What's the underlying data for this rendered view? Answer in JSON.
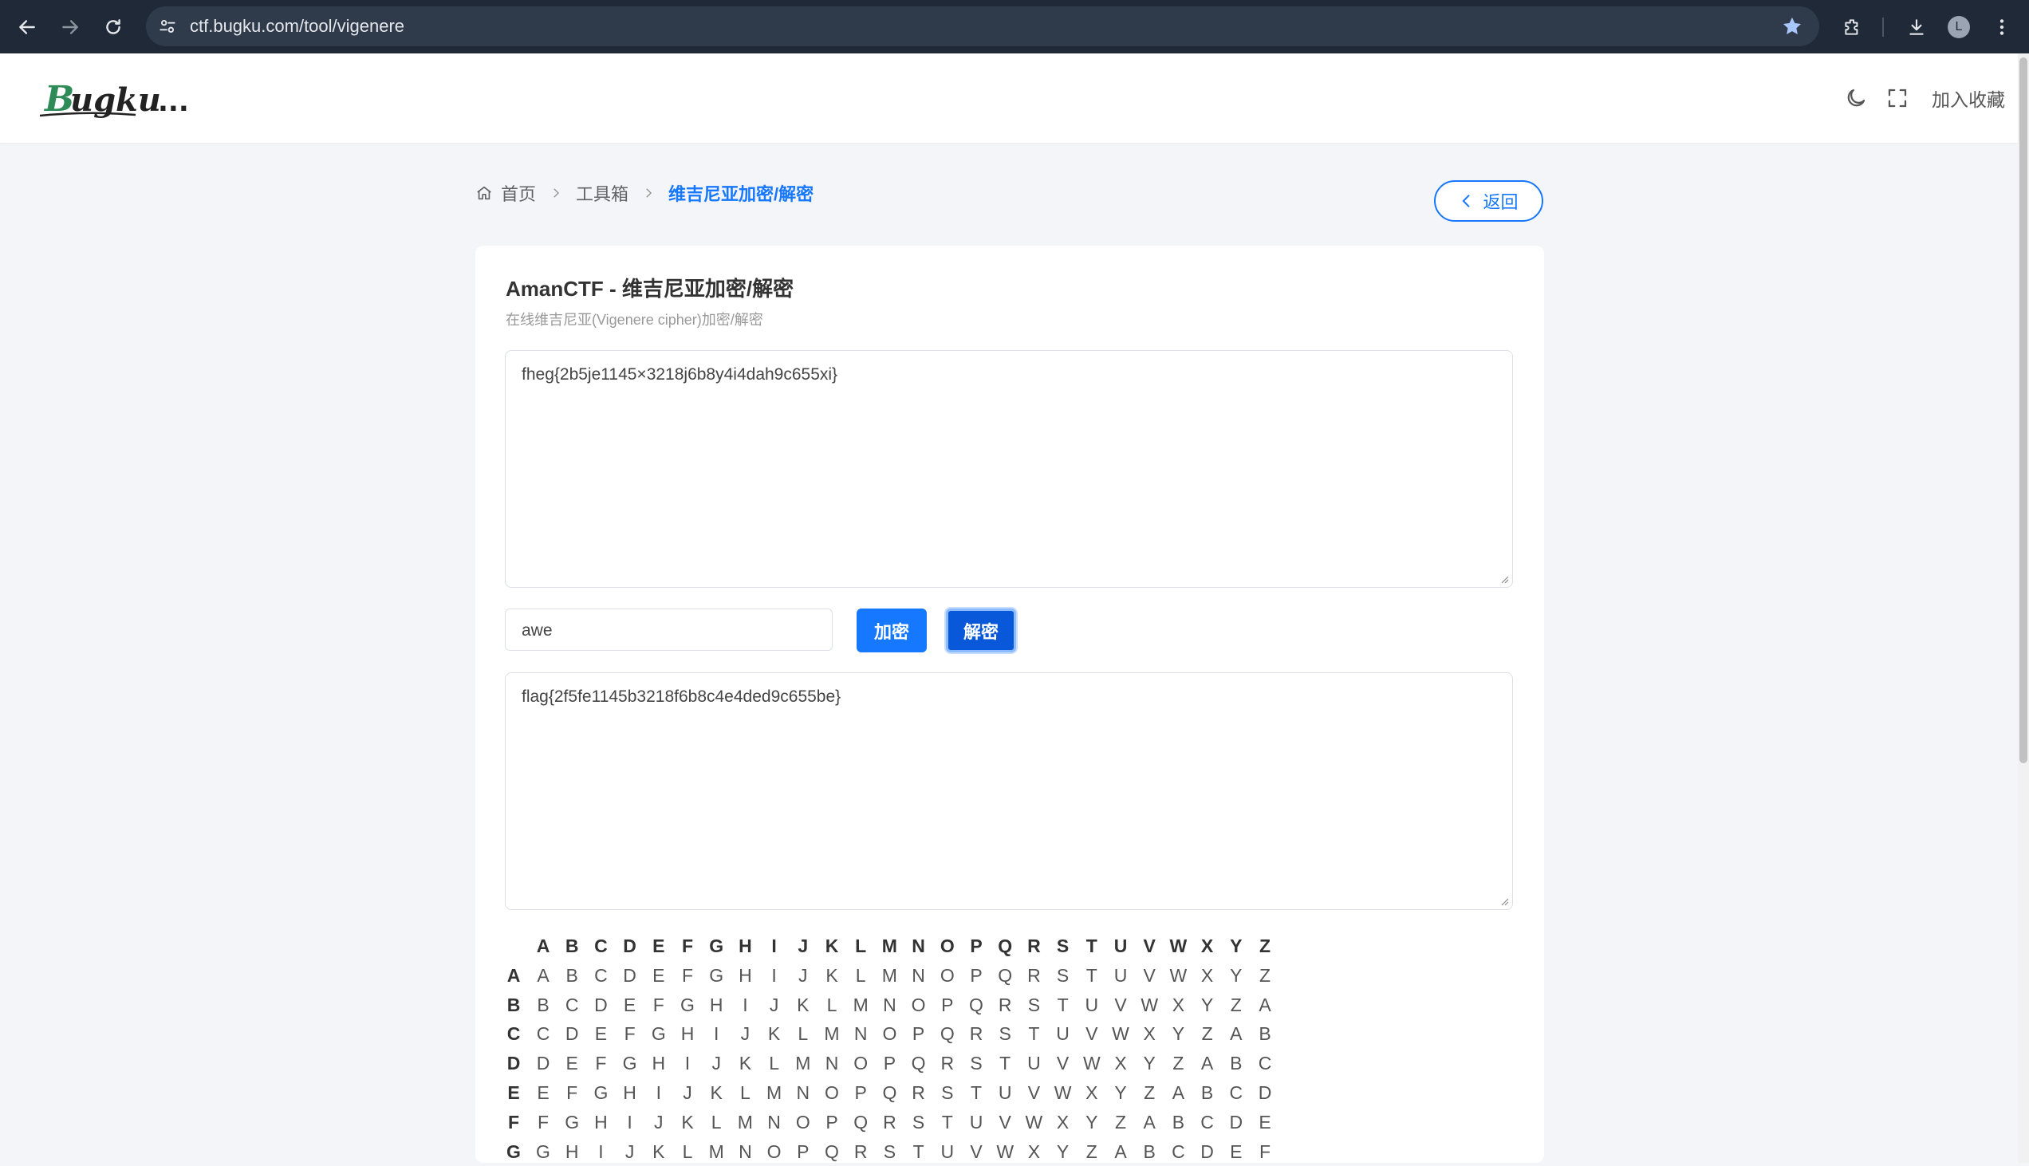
{
  "browser": {
    "url": "ctf.bugku.com/tool/vigenere",
    "avatar_letter": "L"
  },
  "header": {
    "logo_text": "Bugku...",
    "favorite_label": "加入收藏"
  },
  "breadcrumb": {
    "items": [
      "首页",
      "工具箱"
    ],
    "current": "维吉尼亚加密/解密"
  },
  "back_button": {
    "label": "返回"
  },
  "card": {
    "title": "AmanCTF - 维吉尼亚加密/解密",
    "subtitle": "在线维吉尼亚(Vigenere cipher)加密/解密"
  },
  "input_text": "fheg{2b5je1145×3218j6b8y4i4dah9c655xi}",
  "key": "awe",
  "output_text": "flag{2f5fe1145b3218f6b8c4e4ded9c655be}",
  "buttons": {
    "encrypt": "加密",
    "decrypt": "解密"
  },
  "vigenere_table": {
    "header": [
      "A",
      "B",
      "C",
      "D",
      "E",
      "F",
      "G",
      "H",
      "I",
      "J",
      "K",
      "L",
      "M",
      "N",
      "O",
      "P",
      "Q",
      "R",
      "S",
      "T",
      "U",
      "V",
      "W",
      "X",
      "Y",
      "Z"
    ],
    "rows": [
      {
        "label": "A",
        "cells": [
          "A",
          "B",
          "C",
          "D",
          "E",
          "F",
          "G",
          "H",
          "I",
          "J",
          "K",
          "L",
          "M",
          "N",
          "O",
          "P",
          "Q",
          "R",
          "S",
          "T",
          "U",
          "V",
          "W",
          "X",
          "Y",
          "Z"
        ]
      },
      {
        "label": "B",
        "cells": [
          "B",
          "C",
          "D",
          "E",
          "F",
          "G",
          "H",
          "I",
          "J",
          "K",
          "L",
          "M",
          "N",
          "O",
          "P",
          "Q",
          "R",
          "S",
          "T",
          "U",
          "V",
          "W",
          "X",
          "Y",
          "Z",
          "A"
        ]
      },
      {
        "label": "C",
        "cells": [
          "C",
          "D",
          "E",
          "F",
          "G",
          "H",
          "I",
          "J",
          "K",
          "L",
          "M",
          "N",
          "O",
          "P",
          "Q",
          "R",
          "S",
          "T",
          "U",
          "V",
          "W",
          "X",
          "Y",
          "Z",
          "A",
          "B"
        ]
      },
      {
        "label": "D",
        "cells": [
          "D",
          "E",
          "F",
          "G",
          "H",
          "I",
          "J",
          "K",
          "L",
          "M",
          "N",
          "O",
          "P",
          "Q",
          "R",
          "S",
          "T",
          "U",
          "V",
          "W",
          "X",
          "Y",
          "Z",
          "A",
          "B",
          "C"
        ]
      },
      {
        "label": "E",
        "cells": [
          "E",
          "F",
          "G",
          "H",
          "I",
          "J",
          "K",
          "L",
          "M",
          "N",
          "O",
          "P",
          "Q",
          "R",
          "S",
          "T",
          "U",
          "V",
          "W",
          "X",
          "Y",
          "Z",
          "A",
          "B",
          "C",
          "D"
        ]
      },
      {
        "label": "F",
        "cells": [
          "F",
          "G",
          "H",
          "I",
          "J",
          "K",
          "L",
          "M",
          "N",
          "O",
          "P",
          "Q",
          "R",
          "S",
          "T",
          "U",
          "V",
          "W",
          "X",
          "Y",
          "Z",
          "A",
          "B",
          "C",
          "D",
          "E"
        ]
      },
      {
        "label": "G",
        "cells": [
          "G",
          "H",
          "I",
          "J",
          "K",
          "L",
          "M",
          "N",
          "O",
          "P",
          "Q",
          "R",
          "S",
          "T",
          "U",
          "V",
          "W",
          "X",
          "Y",
          "Z",
          "A",
          "B",
          "C",
          "D",
          "E",
          "F"
        ]
      }
    ]
  },
  "colors": {
    "primary": "#1677ff",
    "primary_dark": "#0958d9",
    "chrome": "#1f2937"
  }
}
